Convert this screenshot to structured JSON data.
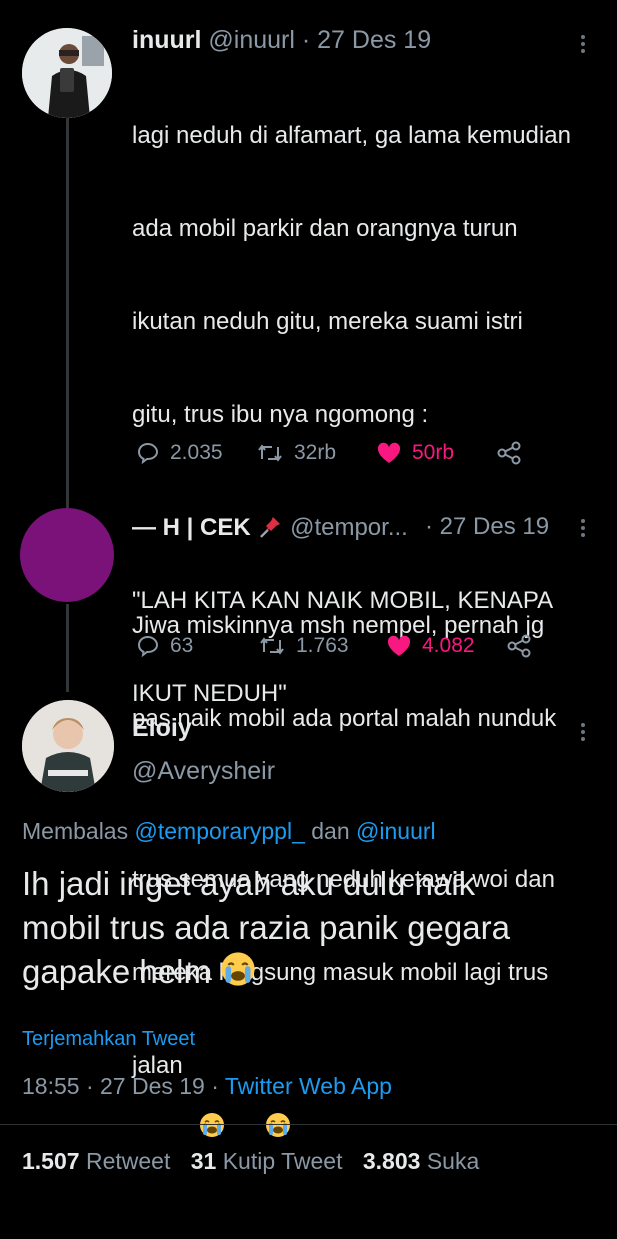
{
  "tweet1": {
    "name": "inuurl",
    "handle": "@inuurl",
    "date": "· 27 Des 19",
    "lines": [
      "lagi neduh di alfamart, ga lama kemudian",
      "ada mobil parkir dan orangnya turun",
      "ikutan neduh gitu, mereka suami istri",
      "gitu, trus ibu nya ngomong :",
      "",
      "\"LAH KITA KAN NAIK MOBIL, KENAPA",
      "IKUT NEDUH\"",
      "",
      "trus semua yang neduh ketawa woi dan",
      "mereka langsung masuk mobil lagi trus",
      "jalan"
    ],
    "replies": "2.035",
    "retweets": "32rb",
    "likes": "50rb"
  },
  "tweet2": {
    "name": "— H | CEK",
    "handle": "@tempor...",
    "date": "· 27 Des 19",
    "lines": [
      "Jiwa miskinnya msh nempel, pernah jg",
      "pas naik mobil ada portal malah nunduk"
    ],
    "replies": "63",
    "retweets": "1.763",
    "likes": "4.082"
  },
  "main": {
    "name": "Eloiy",
    "handle": "@Averysheir",
    "reply_prefix": "Membalas",
    "reply_user1": "@temporaryppl_",
    "reply_and": "dan",
    "reply_user2": "@inuurl",
    "lines": [
      "Ih jadi inget ayah aku dulu naik",
      "mobil trus ada razia panik gegara",
      "gapake helm"
    ],
    "translate": "Terjemahkan Tweet",
    "time": "18:55 · 27 Des 19 ·",
    "source": "Twitter Web App",
    "retweet_count": "1.507",
    "retweet_label": "Retweet",
    "quote_count": "31",
    "quote_label": "Kutip Tweet",
    "like_count": "3.803",
    "like_label": "Suka"
  },
  "colors": {
    "like": "#f91880",
    "link": "#1d9bf0",
    "muted": "#8b98a5",
    "avatar2": "#7a1279"
  },
  "icons": [
    "reply-icon",
    "retweet-icon",
    "heart-icon",
    "share-icon",
    "more-icon",
    "pin-icon",
    "crying-face-icon"
  ]
}
